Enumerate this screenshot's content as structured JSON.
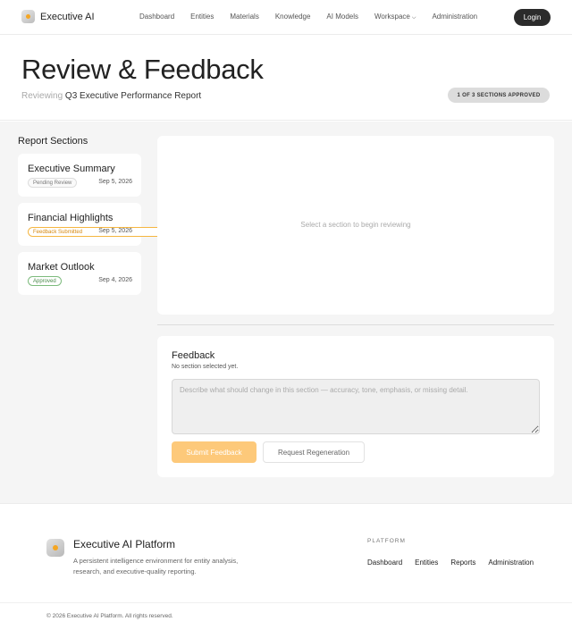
{
  "nav": {
    "brand": "Executive AI",
    "links": [
      "Dashboard",
      "Entities",
      "Materials",
      "Knowledge",
      "AI Models"
    ],
    "workspace": "Workspace",
    "admin": "Administration",
    "login": "Login"
  },
  "hero": {
    "title": "Review & Feedback",
    "sub_prefix": "Reviewing",
    "report_name": "Q3 Executive Performance Report",
    "progress": "1 OF 3 SECTIONS APPROVED"
  },
  "sections": {
    "heading": "Report Sections",
    "items": [
      {
        "title": "Executive Summary",
        "status": "Pending Review",
        "date": "Sep 5, 2026"
      },
      {
        "title": "Financial Highlights",
        "status": "Feedback Submitted",
        "date": "Sep 5, 2026"
      },
      {
        "title": "Market Outlook",
        "status": "Approved",
        "date": "Sep 4, 2026"
      }
    ]
  },
  "preview": {
    "empty_text": "Select a section to begin reviewing"
  },
  "feedback": {
    "title": "Feedback",
    "sub": "No section selected yet.",
    "placeholder": "Describe what should change in this section — accuracy, tone, emphasis, or missing detail.",
    "submit": "Submit Feedback",
    "regenerate": "Request Regeneration"
  },
  "footer": {
    "title": "Executive AI Platform",
    "desc": "A persistent intelligence environment for entity analysis, research, and executive-quality reporting.",
    "col_head": "PLATFORM",
    "links": [
      "Dashboard",
      "Entities",
      "Reports",
      "Administration"
    ],
    "copyright": "© 2026 Executive AI Platform. All rights reserved."
  },
  "colors": {
    "accent": "#f5a623",
    "dark": "#2b2b2b",
    "approved": "#4a8a4a",
    "feedback": "#d68910"
  }
}
